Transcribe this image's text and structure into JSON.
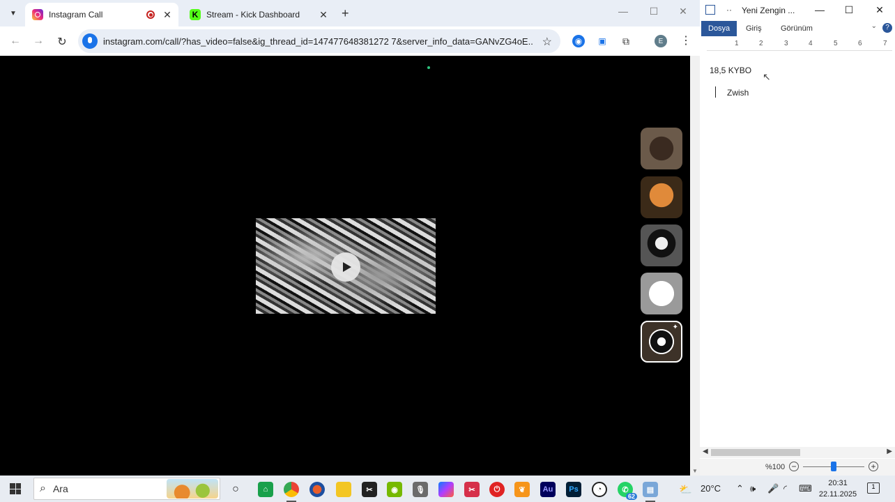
{
  "browser": {
    "tabs": [
      {
        "title": "Instagram Call",
        "active": true,
        "recording": true
      },
      {
        "title": "Stream - Kick Dashboard",
        "active": false
      }
    ],
    "kick_favicon_letter": "K",
    "url": "instagram.com/call/?has_video=false&ig_thread_id=147477648381272 7&server_info_data=GANvZG4oE...",
    "profile_initial": "E",
    "accent": "#1a73e8"
  },
  "word": {
    "doc_title": "Yeni Zengin ...",
    "ribbon_tabs": [
      "Dosya",
      "Giriş",
      "Görünüm"
    ],
    "ruler_marks": [
      "1",
      "2",
      "3",
      "4",
      "5",
      "6",
      "7"
    ],
    "lines": [
      "18,5 KYBO",
      "Zwish"
    ],
    "zoom": "%100",
    "accent": "#2b579a"
  },
  "taskbar": {
    "search_placeholder": "Ara",
    "whatsapp_badge": "62",
    "weather": "20°C",
    "time": "20:31",
    "date": "22.11.2025",
    "notifications": "1",
    "apps": [
      "task-view-icon",
      "app-store-icon",
      "chrome-icon",
      "app-icon",
      "file-explorer-icon",
      "capcut-icon",
      "nvidia-icon",
      "microphone-app-icon",
      "m365-icon",
      "snipping-icon",
      "power-app-icon",
      "fl-studio-icon",
      "audition-icon",
      "photoshop-icon",
      "speedometer-icon",
      "whatsapp-icon",
      "notepad-icon"
    ]
  }
}
